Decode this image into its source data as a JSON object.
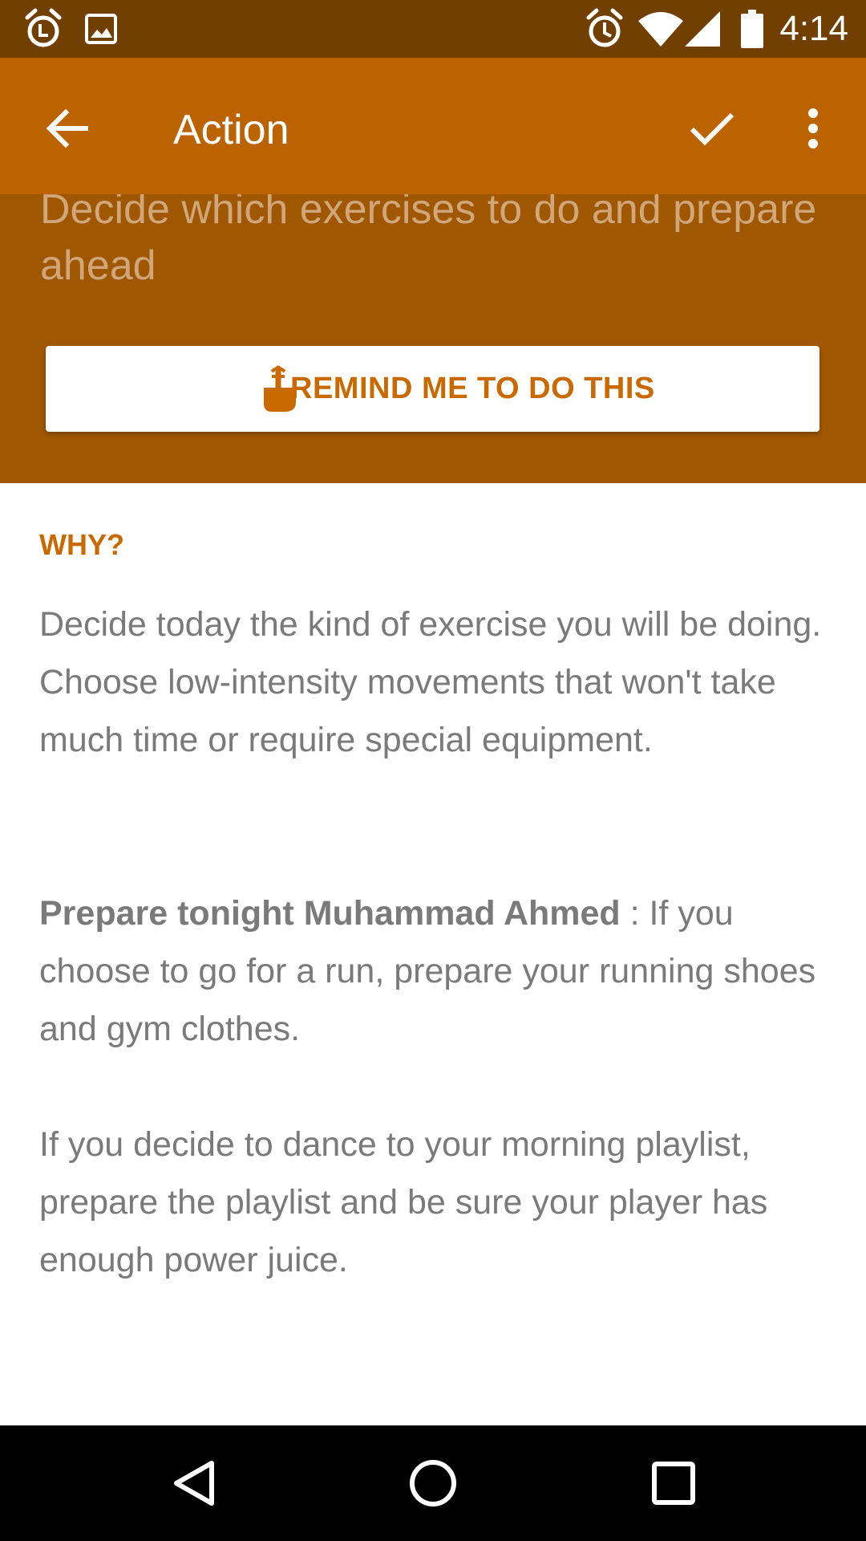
{
  "status_bar": {
    "time": "4:14",
    "left_icons": [
      "alarm-icon",
      "image-icon"
    ],
    "right_icons": [
      "alarm-icon",
      "wifi-icon",
      "cell-signal-icon",
      "battery-icon"
    ]
  },
  "app_bar": {
    "title": "Action",
    "back_icon": "arrow-back-icon",
    "confirm_icon": "check-icon",
    "menu_icon": "more-vert-icon"
  },
  "action": {
    "subtitle": "Decide which exercises to do and prepare ahead",
    "remind_button_label": "REMIND ME TO DO THIS",
    "remind_icon": "finger-string-icon"
  },
  "why": {
    "heading": "WHY?",
    "paragraph1": "Decide today the kind of exercise you will be doing. Choose low-intensity movements that won't take much time or require special equipment.",
    "paragraph2_bold": "Prepare tonight Muhammad Ahmed",
    "paragraph2_rest": " : If you choose to go for a run, prepare your running shoes and gym clothes.",
    "paragraph3": "If you decide to dance to your morning playlist, prepare the playlist and be sure your player has enough power juice."
  },
  "nav_bar": {
    "icons": [
      "back-triangle-icon",
      "home-circle-icon",
      "recents-square-icon"
    ]
  },
  "colors": {
    "status_bar": "#713f00",
    "app_bar": "#ba6300",
    "header": "#a05800",
    "accent": "#c96a00",
    "body_text": "#7a7a7a"
  }
}
